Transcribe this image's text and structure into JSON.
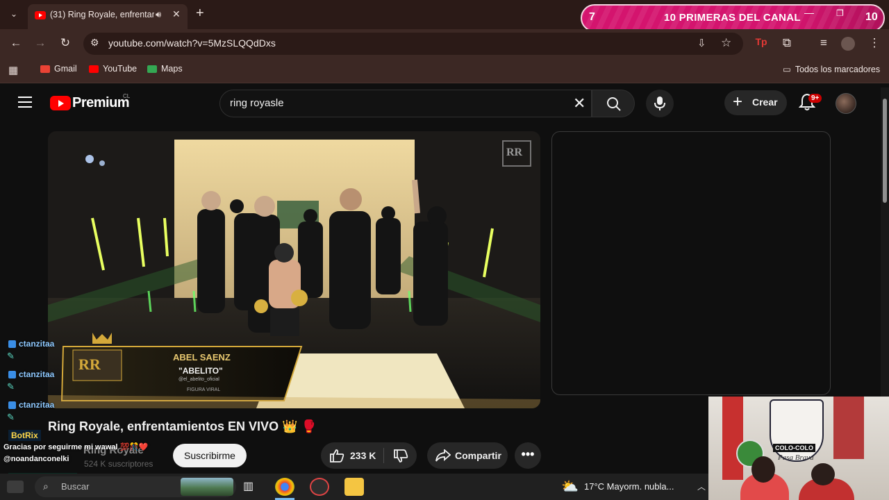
{
  "browser": {
    "tab_title": "(31) Ring Royale, enfrentam",
    "url": "youtube.com/watch?v=5MzSLQQdDxs",
    "bookmarks": [
      {
        "label": "Gmail",
        "color": "#ea4335"
      },
      {
        "label": "YouTube",
        "color": "#ff0000"
      },
      {
        "label": "Maps",
        "color": "#34a853"
      }
    ],
    "all_bookmarks_label": "Todos los marcadores"
  },
  "stream_banner": {
    "left_number": "7",
    "title": "10 PRIMERAS DEL CANAL",
    "right_number": "10"
  },
  "youtube": {
    "brand": "Premium",
    "country": "CL",
    "search_query": "ring royasle",
    "create_label": "Crear",
    "notification_count": "9+",
    "video_title": "Ring Royale, enfrentamientos EN VIVO 👑 🥊",
    "channel_name": "Ring Royale",
    "subscribers": "524 K suscriptores",
    "subscribe_label": "Suscribirme",
    "like_count": "233 K",
    "share_label": "Compartir",
    "more_label": "•••"
  },
  "video_overlay": {
    "logo": "RR",
    "name": "ABEL SAENZ",
    "nickname": "\"ABELITO\"",
    "handle": "@el_abelito_oficial",
    "tag": "FIGURA VIRAL",
    "watermark": "RR"
  },
  "chat": {
    "messages": [
      {
        "user": "ctanzitaa"
      },
      {
        "user": "ctanzitaa"
      },
      {
        "user": "ctanzitaa"
      }
    ],
    "bot_user": "BotRix",
    "bot_message": "Gracias por seguirme mi wawal 💯🎊❤️",
    "bot_mention": "@noandanconelki",
    "last_user": "noandanconelki"
  },
  "taskbar": {
    "search_placeholder": "Buscar",
    "weather": "17°C  Mayorm. nubla..."
  },
  "webcam": {
    "banner_text": "COLO-COLO",
    "flag_text": "Pasa Brava"
  },
  "colors": {
    "youtube_red": "#ff0000",
    "banner_pink": "#d4146e",
    "chrome_brown": "#3c2824"
  }
}
